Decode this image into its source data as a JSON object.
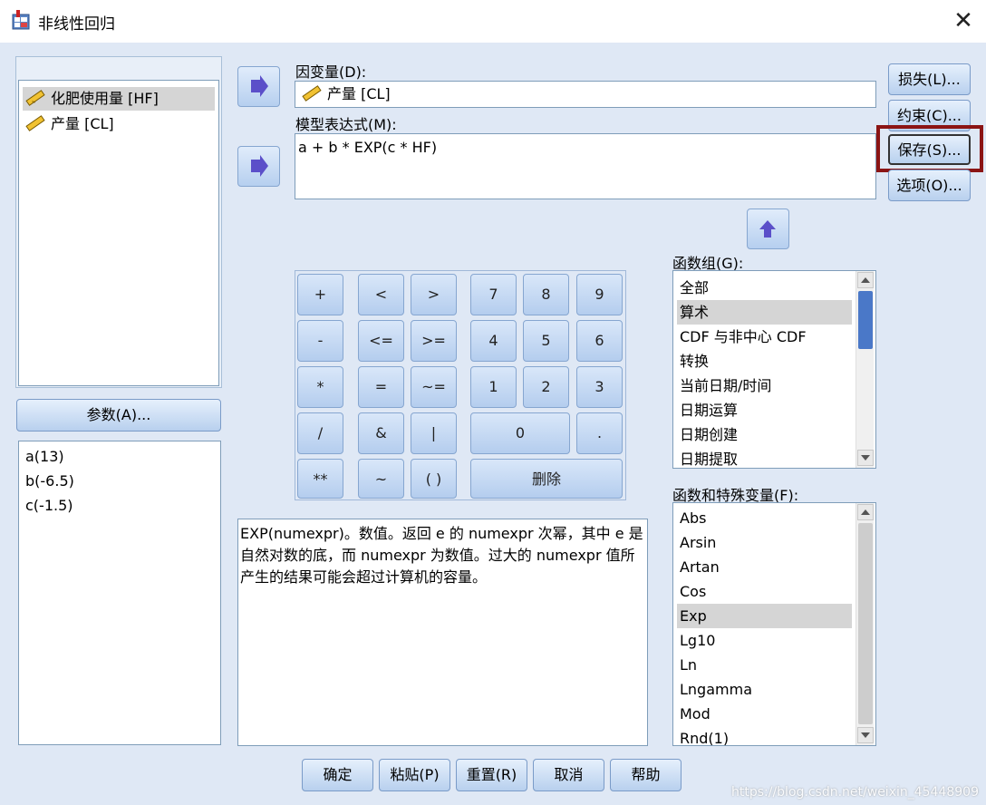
{
  "window": {
    "title": "非线性回归",
    "close_glyph": "✕"
  },
  "variables": [
    {
      "label": "化肥使用量 [HF]",
      "selected": true,
      "icon": "ruler-icon"
    },
    {
      "label": "产量 [CL]",
      "selected": false,
      "icon": "ruler-icon"
    }
  ],
  "params_button": "参数(A)...",
  "params": [
    "a(13)",
    "b(-6.5)",
    "c(-1.5)"
  ],
  "dependent": {
    "label": "因变量(D):",
    "value": "产量 [CL]"
  },
  "model": {
    "label": "模型表达式(M):",
    "value": "a + b * EXP(c * HF)"
  },
  "side_buttons": [
    "损失(L)...",
    "约束(C)...",
    "保存(S)...",
    "选项(O)..."
  ],
  "calculator": {
    "ops": [
      "+",
      "<",
      ">",
      "-",
      "<=",
      ">=",
      "*",
      "=",
      "~=",
      "/",
      "&",
      "|",
      "**",
      "~",
      "( )"
    ],
    "digits": [
      "7",
      "8",
      "9",
      "4",
      "5",
      "6",
      "1",
      "2",
      "3",
      "0",
      "."
    ],
    "delete": "删除"
  },
  "description": "EXP(numexpr)。数值。返回 e 的 numexpr 次幂，其中 e 是自然对数的底，而 numexpr 为数值。过大的 numexpr 值所产生的结果可能会超过计算机的容量。",
  "function_groups": {
    "label": "函数组(G):",
    "items": [
      "全部",
      "算术",
      "CDF 与非中心 CDF",
      "转换",
      "当前日期/时间",
      "日期运算",
      "日期创建",
      "日期提取"
    ],
    "selected_index": 1
  },
  "functions": {
    "label": "函数和特殊变量(F):",
    "items": [
      "Abs",
      "Arsin",
      "Artan",
      "Cos",
      "Exp",
      "Lg10",
      "Ln",
      "Lngamma",
      "Mod",
      "Rnd(1)"
    ],
    "selected_index": 4
  },
  "bottom_buttons": [
    "确定",
    "粘贴(P)",
    "重置(R)",
    "取消",
    "帮助"
  ],
  "watermark": "https://blog.csdn.net/weixin_45448909",
  "colors": {
    "highlight_border": "#8b1414",
    "arrow": "#5b4fc9"
  }
}
